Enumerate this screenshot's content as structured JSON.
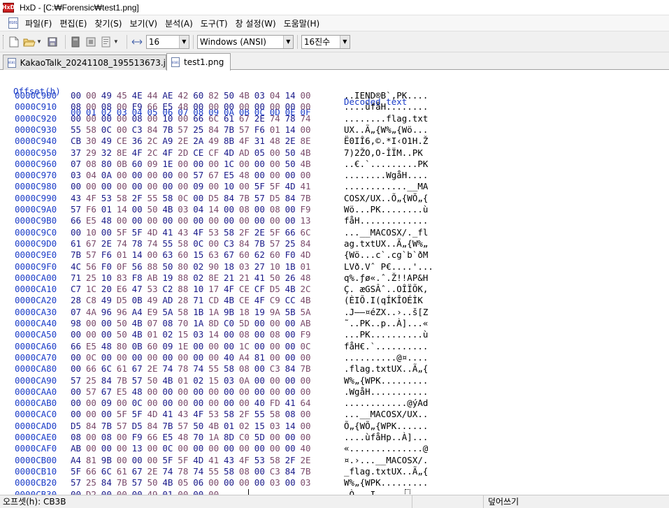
{
  "window": {
    "title": "HxD - [C:₩Forensic₩test1.png]",
    "app_icon_text": "HxD"
  },
  "menu": {
    "items": [
      "파일(F)",
      "편집(E)",
      "찾기(S)",
      "보기(V)",
      "분석(A)",
      "도구(T)",
      "창 설정(W)",
      "도움말(H)"
    ]
  },
  "toolbar": {
    "bytes_per_row": "16",
    "charset": "Windows (ANSI)",
    "offset_base": "16진수"
  },
  "tabs": [
    {
      "label": "KakaoTalk_20241108_195513673.jpg",
      "active": false
    },
    {
      "label": "test1.png",
      "active": true
    }
  ],
  "hex": {
    "header_offset": "Offset(h)",
    "header_decoded": "Decoded text",
    "columns": [
      "00",
      "01",
      "02",
      "03",
      "04",
      "05",
      "06",
      "07",
      "08",
      "09",
      "0A",
      "0B",
      "0C",
      "0D",
      "0E",
      "0F"
    ],
    "rows": [
      {
        "offset": "0000C900",
        "bytes": [
          "00",
          "00",
          "49",
          "45",
          "4E",
          "44",
          "AE",
          "42",
          "60",
          "82",
          "50",
          "4B",
          "03",
          "04",
          "14",
          "00"
        ],
        "text": "..IEND®B`‚PK...."
      },
      {
        "offset": "0000C910",
        "bytes": [
          "08",
          "00",
          "08",
          "00",
          "F9",
          "66",
          "E5",
          "48",
          "00",
          "00",
          "00",
          "00",
          "00",
          "00",
          "00",
          "00"
        ],
        "text": "....ùfåH........"
      },
      {
        "offset": "0000C920",
        "bytes": [
          "00",
          "00",
          "00",
          "00",
          "08",
          "00",
          "10",
          "00",
          "66",
          "6C",
          "61",
          "67",
          "2E",
          "74",
          "78",
          "74"
        ],
        "text": "........flag.txt"
      },
      {
        "offset": "0000C930",
        "bytes": [
          "55",
          "58",
          "0C",
          "00",
          "C3",
          "84",
          "7B",
          "57",
          "25",
          "84",
          "7B",
          "57",
          "F6",
          "01",
          "14",
          "00"
        ],
        "text": "UX..Ã„{W%„{Wö..."
      },
      {
        "offset": "0000C940",
        "bytes": [
          "CB",
          "30",
          "49",
          "CE",
          "36",
          "2C",
          "A9",
          "2E",
          "2A",
          "49",
          "8B",
          "4F",
          "31",
          "48",
          "2E",
          "8E"
        ],
        "text": "Ë0IÎ6,©.*I‹O1H.Ž"
      },
      {
        "offset": "0000C950",
        "bytes": [
          "37",
          "29",
          "32",
          "8E",
          "4F",
          "2C",
          "4F",
          "2D",
          "CE",
          "CF",
          "4D",
          "AD",
          "05",
          "00",
          "50",
          "4B"
        ],
        "text": "7)2ŽO,O-ÎÏM­..PK"
      },
      {
        "offset": "0000C960",
        "bytes": [
          "07",
          "08",
          "80",
          "0B",
          "60",
          "09",
          "1E",
          "00",
          "00",
          "00",
          "1C",
          "00",
          "00",
          "00",
          "50",
          "4B"
        ],
        "text": "..€.`.........PK"
      },
      {
        "offset": "0000C970",
        "bytes": [
          "03",
          "04",
          "0A",
          "00",
          "00",
          "00",
          "00",
          "00",
          "57",
          "67",
          "E5",
          "48",
          "00",
          "00",
          "00",
          "00"
        ],
        "text": "........WgåH...."
      },
      {
        "offset": "0000C980",
        "bytes": [
          "00",
          "00",
          "00",
          "00",
          "00",
          "00",
          "00",
          "00",
          "09",
          "00",
          "10",
          "00",
          "5F",
          "5F",
          "4D",
          "41"
        ],
        "text": "............__MA"
      },
      {
        "offset": "0000C990",
        "bytes": [
          "43",
          "4F",
          "53",
          "58",
          "2F",
          "55",
          "58",
          "0C",
          "00",
          "D5",
          "84",
          "7B",
          "57",
          "D5",
          "84",
          "7B"
        ],
        "text": "COSX/UX..Õ„{WÕ„{"
      },
      {
        "offset": "0000C9A0",
        "bytes": [
          "57",
          "F6",
          "01",
          "14",
          "00",
          "50",
          "4B",
          "03",
          "04",
          "14",
          "00",
          "08",
          "00",
          "08",
          "00",
          "F9"
        ],
        "text": "Wö...PK........ù"
      },
      {
        "offset": "0000C9B0",
        "bytes": [
          "66",
          "E5",
          "48",
          "00",
          "00",
          "00",
          "00",
          "00",
          "00",
          "00",
          "00",
          "00",
          "00",
          "00",
          "00",
          "13"
        ],
        "text": "fåH............."
      },
      {
        "offset": "0000C9C0",
        "bytes": [
          "00",
          "10",
          "00",
          "5F",
          "5F",
          "4D",
          "41",
          "43",
          "4F",
          "53",
          "58",
          "2F",
          "2E",
          "5F",
          "66",
          "6C"
        ],
        "text": "...__MACOSX/._fl"
      },
      {
        "offset": "0000C9D0",
        "bytes": [
          "61",
          "67",
          "2E",
          "74",
          "78",
          "74",
          "55",
          "58",
          "0C",
          "00",
          "C3",
          "84",
          "7B",
          "57",
          "25",
          "84"
        ],
        "text": "ag.txtUX..Ã„{W%„"
      },
      {
        "offset": "0000C9E0",
        "bytes": [
          "7B",
          "57",
          "F6",
          "01",
          "14",
          "00",
          "63",
          "60",
          "15",
          "63",
          "67",
          "60",
          "62",
          "60",
          "F0",
          "4D"
        ],
        "text": "{Wö...c`.cg`b`ðM"
      },
      {
        "offset": "0000C9F0",
        "bytes": [
          "4C",
          "56",
          "F0",
          "0F",
          "56",
          "88",
          "50",
          "80",
          "02",
          "90",
          "18",
          "03",
          "27",
          "10",
          "1B",
          "01"
        ],
        "text": "LVð.Vˆ P€....'..."
      },
      {
        "offset": "0000CA00",
        "bytes": [
          "71",
          "25",
          "10",
          "83",
          "F8",
          "AB",
          "19",
          "88",
          "02",
          "8E",
          "21",
          "21",
          "41",
          "50",
          "26",
          "48"
        ],
        "text": "q%.ƒø«.ˆ.Ž!!AP&H"
      },
      {
        "offset": "0000CA10",
        "bytes": [
          "C7",
          "1C",
          "20",
          "E6",
          "47",
          "53",
          "C2",
          "88",
          "10",
          "17",
          "4F",
          "CE",
          "CF",
          "D5",
          "4B",
          "2C"
        ],
        "text": "Ç. æGSÂˆ..OÎÏÕK,"
      },
      {
        "offset": "0000CA20",
        "bytes": [
          "28",
          "C8",
          "49",
          "D5",
          "0B",
          "49",
          "AD",
          "28",
          "71",
          "CD",
          "4B",
          "CE",
          "4F",
          "C9",
          "CC",
          "4B"
        ],
        "text": "(ÈIÕ.I­(qÍKÎOÉÌK"
      },
      {
        "offset": "0000CA30",
        "bytes": [
          "07",
          "4A",
          "96",
          "96",
          "A4",
          "E9",
          "5A",
          "58",
          "1B",
          "1A",
          "9B",
          "18",
          "19",
          "9A",
          "5B",
          "5A"
        ],
        "text": ".J––¤éZX..›..š[Z"
      },
      {
        "offset": "0000CA40",
        "bytes": [
          "98",
          "00",
          "00",
          "50",
          "4B",
          "07",
          "08",
          "70",
          "1A",
          "8D",
          "C0",
          "5D",
          "00",
          "00",
          "00",
          "AB"
        ],
        "text": "˜..PK..p..À]...«"
      },
      {
        "offset": "0000CA50",
        "bytes": [
          "00",
          "00",
          "00",
          "50",
          "4B",
          "01",
          "02",
          "15",
          "03",
          "14",
          "00",
          "08",
          "00",
          "08",
          "00",
          "F9"
        ],
        "text": "...PK..........ù"
      },
      {
        "offset": "0000CA60",
        "bytes": [
          "66",
          "E5",
          "48",
          "80",
          "0B",
          "60",
          "09",
          "1E",
          "00",
          "00",
          "00",
          "1C",
          "00",
          "00",
          "00",
          "0C"
        ],
        "text": "fåH€.`.........."
      },
      {
        "offset": "0000CA70",
        "bytes": [
          "00",
          "0C",
          "00",
          "00",
          "00",
          "00",
          "00",
          "00",
          "00",
          "00",
          "40",
          "A4",
          "81",
          "00",
          "00",
          "00"
        ],
        "text": "..........@¤...."
      },
      {
        "offset": "0000CA80",
        "bytes": [
          "00",
          "66",
          "6C",
          "61",
          "67",
          "2E",
          "74",
          "78",
          "74",
          "55",
          "58",
          "08",
          "00",
          "C3",
          "84",
          "7B"
        ],
        "text": ".flag.txtUX..Ã„{"
      },
      {
        "offset": "0000CA90",
        "bytes": [
          "57",
          "25",
          "84",
          "7B",
          "57",
          "50",
          "4B",
          "01",
          "02",
          "15",
          "03",
          "0A",
          "00",
          "00",
          "00",
          "00"
        ],
        "text": "W%„{WPK........."
      },
      {
        "offset": "0000CAA0",
        "bytes": [
          "00",
          "57",
          "67",
          "E5",
          "48",
          "00",
          "00",
          "00",
          "00",
          "00",
          "00",
          "00",
          "00",
          "00",
          "00",
          "00"
        ],
        "text": ".WgåH..........."
      },
      {
        "offset": "0000CAB0",
        "bytes": [
          "00",
          "00",
          "09",
          "00",
          "0C",
          "00",
          "00",
          "00",
          "00",
          "00",
          "00",
          "00",
          "40",
          "FD",
          "41",
          "64"
        ],
        "text": "............@ýAd"
      },
      {
        "offset": "0000CAC0",
        "bytes": [
          "00",
          "00",
          "00",
          "5F",
          "5F",
          "4D",
          "41",
          "43",
          "4F",
          "53",
          "58",
          "2F",
          "55",
          "58",
          "08",
          "00"
        ],
        "text": "...__MACOSX/UX.."
      },
      {
        "offset": "0000CAD0",
        "bytes": [
          "D5",
          "84",
          "7B",
          "57",
          "D5",
          "84",
          "7B",
          "57",
          "50",
          "4B",
          "01",
          "02",
          "15",
          "03",
          "14",
          "00"
        ],
        "text": "Õ„{WÕ„{WPK......"
      },
      {
        "offset": "0000CAE0",
        "bytes": [
          "08",
          "00",
          "08",
          "00",
          "F9",
          "66",
          "E5",
          "48",
          "70",
          "1A",
          "8D",
          "C0",
          "5D",
          "00",
          "00",
          "00"
        ],
        "text": "....ùfåHp..À]..."
      },
      {
        "offset": "0000CAF0",
        "bytes": [
          "AB",
          "00",
          "00",
          "00",
          "13",
          "00",
          "0C",
          "00",
          "00",
          "00",
          "00",
          "00",
          "00",
          "00",
          "00",
          "40"
        ],
        "text": "«..............@"
      },
      {
        "offset": "0000CB00",
        "bytes": [
          "A4",
          "81",
          "9B",
          "00",
          "00",
          "00",
          "5F",
          "5F",
          "4D",
          "41",
          "43",
          "4F",
          "53",
          "58",
          "2F",
          "2E"
        ],
        "text": "¤.›...__MACOSX/."
      },
      {
        "offset": "0000CB10",
        "bytes": [
          "5F",
          "66",
          "6C",
          "61",
          "67",
          "2E",
          "74",
          "78",
          "74",
          "55",
          "58",
          "08",
          "00",
          "C3",
          "84",
          "7B"
        ],
        "text": "_flag.txtUX..Ã„{"
      },
      {
        "offset": "0000CB20",
        "bytes": [
          "57",
          "25",
          "84",
          "7B",
          "57",
          "50",
          "4B",
          "05",
          "06",
          "00",
          "00",
          "00",
          "00",
          "03",
          "00",
          "03"
        ],
        "text": "W%„{WPK........."
      },
      {
        "offset": "0000CB30",
        "bytes": [
          "00",
          "D2",
          "00",
          "00",
          "00",
          "49",
          "01",
          "00",
          "00",
          "00",
          "",
          "",
          "",
          "",
          "",
          ""
        ],
        "text": ".Ò...I...."
      }
    ]
  },
  "status": {
    "offset_text": "오프셋(h): CB3B",
    "mode_text": "덮어쓰기"
  }
}
